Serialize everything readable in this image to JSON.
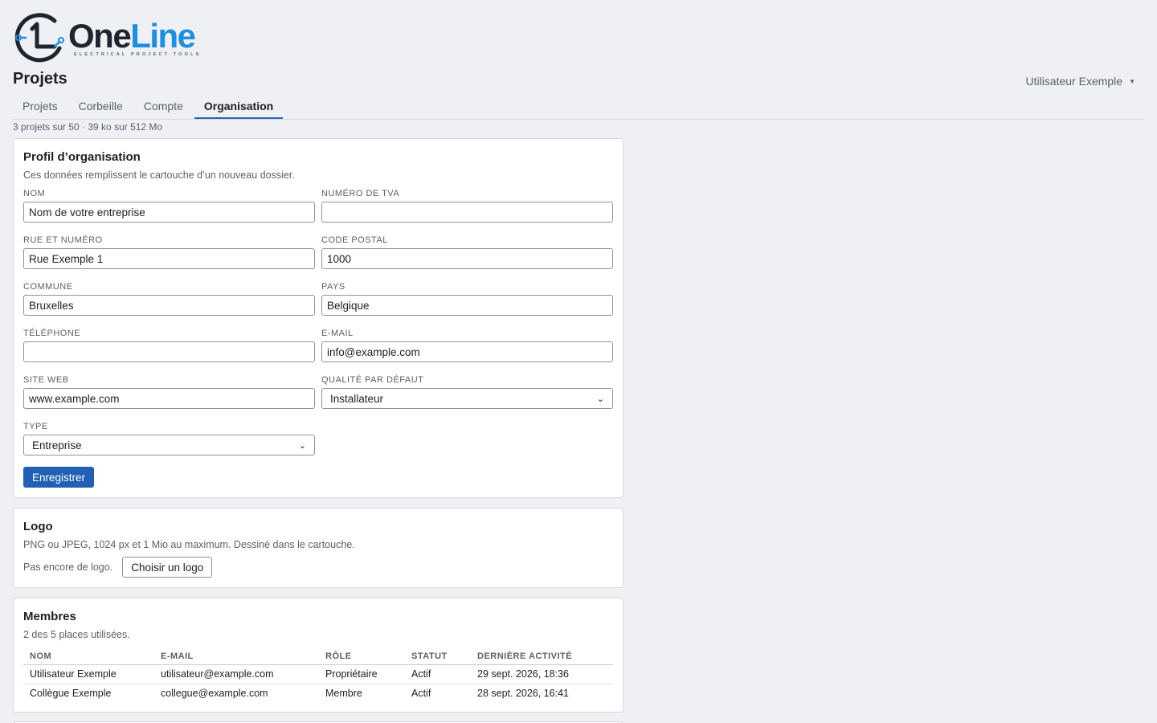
{
  "brand": {
    "name_part1": "One",
    "name_part2": "Line",
    "tagline": "ELECTRICAL PROJECT TOOLS",
    "primary_color": "#1d8fe0",
    "dark_color": "#1e2530"
  },
  "header": {
    "title": "Projets",
    "user_name": "Utilisateur Exemple"
  },
  "tabs": [
    {
      "label": "Projets",
      "active": false
    },
    {
      "label": "Corbeille",
      "active": false
    },
    {
      "label": "Compte",
      "active": false
    },
    {
      "label": "Organisation",
      "active": true
    }
  ],
  "quota": "3 projets sur 50 · 39 ko sur 512 Mo",
  "profile": {
    "title": "Profil d’organisation",
    "description": "Ces données remplissent le cartouche d’un nouveau dossier.",
    "fields": {
      "name": {
        "label": "NOM",
        "value": "Nom de votre entreprise"
      },
      "vat": {
        "label": "NUMÉRO DE TVA",
        "value": ""
      },
      "street": {
        "label": "RUE ET NUMÉRO",
        "value": "Rue Exemple 1"
      },
      "postal": {
        "label": "CODE POSTAL",
        "value": "1000"
      },
      "city": {
        "label": "COMMUNE",
        "value": "Bruxelles"
      },
      "country": {
        "label": "PAYS",
        "value": "Belgique"
      },
      "phone": {
        "label": "TÉLÉPHONE",
        "value": ""
      },
      "email": {
        "label": "E-MAIL",
        "value": "info@example.com"
      },
      "website": {
        "label": "SITE WEB",
        "value": "www.example.com"
      },
      "quality": {
        "label": "QUALITÉ PAR DÉFAUT",
        "value": "Installateur"
      },
      "type": {
        "label": "TYPE",
        "value": "Entreprise"
      }
    },
    "save_label": "Enregistrer",
    "save_color": "#2160b4"
  },
  "logo_section": {
    "title": "Logo",
    "description": "PNG ou JPEG, 1024 px et 1 Mio au maximum. Dessiné dans le cartouche.",
    "empty_text": "Pas encore de logo.",
    "choose_label": "Choisir un logo"
  },
  "members": {
    "title": "Membres",
    "description": "2 des 5 places utilisées.",
    "columns": [
      "NOM",
      "E-MAIL",
      "RÔLE",
      "STATUT",
      "DERNIÈRE ACTIVITÉ"
    ],
    "rows": [
      [
        "Utilisateur Exemple",
        "utilisateur@example.com",
        "Propriétaire",
        "Actif",
        "29 sept. 2026, 18:36"
      ],
      [
        "Collègue Exemple",
        "collegue@example.com",
        "Membre",
        "Actif",
        "28 sept. 2026, 16:41"
      ]
    ]
  }
}
